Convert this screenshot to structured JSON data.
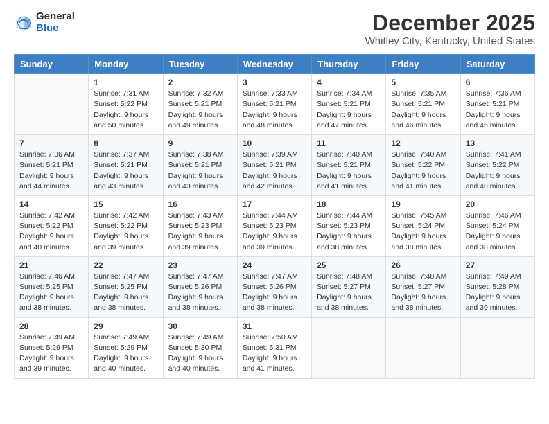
{
  "logo": {
    "general": "General",
    "blue": "Blue"
  },
  "title": "December 2025",
  "subtitle": "Whitley City, Kentucky, United States",
  "weekdays": [
    "Sunday",
    "Monday",
    "Tuesday",
    "Wednesday",
    "Thursday",
    "Friday",
    "Saturday"
  ],
  "weeks": [
    [
      {
        "day": "",
        "sunrise": "",
        "sunset": "",
        "daylight": ""
      },
      {
        "day": "1",
        "sunrise": "Sunrise: 7:31 AM",
        "sunset": "Sunset: 5:22 PM",
        "daylight": "Daylight: 9 hours and 50 minutes."
      },
      {
        "day": "2",
        "sunrise": "Sunrise: 7:32 AM",
        "sunset": "Sunset: 5:21 PM",
        "daylight": "Daylight: 9 hours and 49 minutes."
      },
      {
        "day": "3",
        "sunrise": "Sunrise: 7:33 AM",
        "sunset": "Sunset: 5:21 PM",
        "daylight": "Daylight: 9 hours and 48 minutes."
      },
      {
        "day": "4",
        "sunrise": "Sunrise: 7:34 AM",
        "sunset": "Sunset: 5:21 PM",
        "daylight": "Daylight: 9 hours and 47 minutes."
      },
      {
        "day": "5",
        "sunrise": "Sunrise: 7:35 AM",
        "sunset": "Sunset: 5:21 PM",
        "daylight": "Daylight: 9 hours and 46 minutes."
      },
      {
        "day": "6",
        "sunrise": "Sunrise: 7:36 AM",
        "sunset": "Sunset: 5:21 PM",
        "daylight": "Daylight: 9 hours and 45 minutes."
      }
    ],
    [
      {
        "day": "7",
        "sunrise": "Sunrise: 7:36 AM",
        "sunset": "Sunset: 5:21 PM",
        "daylight": "Daylight: 9 hours and 44 minutes."
      },
      {
        "day": "8",
        "sunrise": "Sunrise: 7:37 AM",
        "sunset": "Sunset: 5:21 PM",
        "daylight": "Daylight: 9 hours and 43 minutes."
      },
      {
        "day": "9",
        "sunrise": "Sunrise: 7:38 AM",
        "sunset": "Sunset: 5:21 PM",
        "daylight": "Daylight: 9 hours and 43 minutes."
      },
      {
        "day": "10",
        "sunrise": "Sunrise: 7:39 AM",
        "sunset": "Sunset: 5:21 PM",
        "daylight": "Daylight: 9 hours and 42 minutes."
      },
      {
        "day": "11",
        "sunrise": "Sunrise: 7:40 AM",
        "sunset": "Sunset: 5:21 PM",
        "daylight": "Daylight: 9 hours and 41 minutes."
      },
      {
        "day": "12",
        "sunrise": "Sunrise: 7:40 AM",
        "sunset": "Sunset: 5:22 PM",
        "daylight": "Daylight: 9 hours and 41 minutes."
      },
      {
        "day": "13",
        "sunrise": "Sunrise: 7:41 AM",
        "sunset": "Sunset: 5:22 PM",
        "daylight": "Daylight: 9 hours and 40 minutes."
      }
    ],
    [
      {
        "day": "14",
        "sunrise": "Sunrise: 7:42 AM",
        "sunset": "Sunset: 5:22 PM",
        "daylight": "Daylight: 9 hours and 40 minutes."
      },
      {
        "day": "15",
        "sunrise": "Sunrise: 7:42 AM",
        "sunset": "Sunset: 5:22 PM",
        "daylight": "Daylight: 9 hours and 39 minutes."
      },
      {
        "day": "16",
        "sunrise": "Sunrise: 7:43 AM",
        "sunset": "Sunset: 5:23 PM",
        "daylight": "Daylight: 9 hours and 39 minutes."
      },
      {
        "day": "17",
        "sunrise": "Sunrise: 7:44 AM",
        "sunset": "Sunset: 5:23 PM",
        "daylight": "Daylight: 9 hours and 39 minutes."
      },
      {
        "day": "18",
        "sunrise": "Sunrise: 7:44 AM",
        "sunset": "Sunset: 5:23 PM",
        "daylight": "Daylight: 9 hours and 38 minutes."
      },
      {
        "day": "19",
        "sunrise": "Sunrise: 7:45 AM",
        "sunset": "Sunset: 5:24 PM",
        "daylight": "Daylight: 9 hours and 38 minutes."
      },
      {
        "day": "20",
        "sunrise": "Sunrise: 7:46 AM",
        "sunset": "Sunset: 5:24 PM",
        "daylight": "Daylight: 9 hours and 38 minutes."
      }
    ],
    [
      {
        "day": "21",
        "sunrise": "Sunrise: 7:46 AM",
        "sunset": "Sunset: 5:25 PM",
        "daylight": "Daylight: 9 hours and 38 minutes."
      },
      {
        "day": "22",
        "sunrise": "Sunrise: 7:47 AM",
        "sunset": "Sunset: 5:25 PM",
        "daylight": "Daylight: 9 hours and 38 minutes."
      },
      {
        "day": "23",
        "sunrise": "Sunrise: 7:47 AM",
        "sunset": "Sunset: 5:26 PM",
        "daylight": "Daylight: 9 hours and 38 minutes."
      },
      {
        "day": "24",
        "sunrise": "Sunrise: 7:47 AM",
        "sunset": "Sunset: 5:26 PM",
        "daylight": "Daylight: 9 hours and 38 minutes."
      },
      {
        "day": "25",
        "sunrise": "Sunrise: 7:48 AM",
        "sunset": "Sunset: 5:27 PM",
        "daylight": "Daylight: 9 hours and 38 minutes."
      },
      {
        "day": "26",
        "sunrise": "Sunrise: 7:48 AM",
        "sunset": "Sunset: 5:27 PM",
        "daylight": "Daylight: 9 hours and 38 minutes."
      },
      {
        "day": "27",
        "sunrise": "Sunrise: 7:49 AM",
        "sunset": "Sunset: 5:28 PM",
        "daylight": "Daylight: 9 hours and 39 minutes."
      }
    ],
    [
      {
        "day": "28",
        "sunrise": "Sunrise: 7:49 AM",
        "sunset": "Sunset: 5:29 PM",
        "daylight": "Daylight: 9 hours and 39 minutes."
      },
      {
        "day": "29",
        "sunrise": "Sunrise: 7:49 AM",
        "sunset": "Sunset: 5:29 PM",
        "daylight": "Daylight: 9 hours and 40 minutes."
      },
      {
        "day": "30",
        "sunrise": "Sunrise: 7:49 AM",
        "sunset": "Sunset: 5:30 PM",
        "daylight": "Daylight: 9 hours and 40 minutes."
      },
      {
        "day": "31",
        "sunrise": "Sunrise: 7:50 AM",
        "sunset": "Sunset: 5:31 PM",
        "daylight": "Daylight: 9 hours and 41 minutes."
      },
      {
        "day": "",
        "sunrise": "",
        "sunset": "",
        "daylight": ""
      },
      {
        "day": "",
        "sunrise": "",
        "sunset": "",
        "daylight": ""
      },
      {
        "day": "",
        "sunrise": "",
        "sunset": "",
        "daylight": ""
      }
    ]
  ]
}
